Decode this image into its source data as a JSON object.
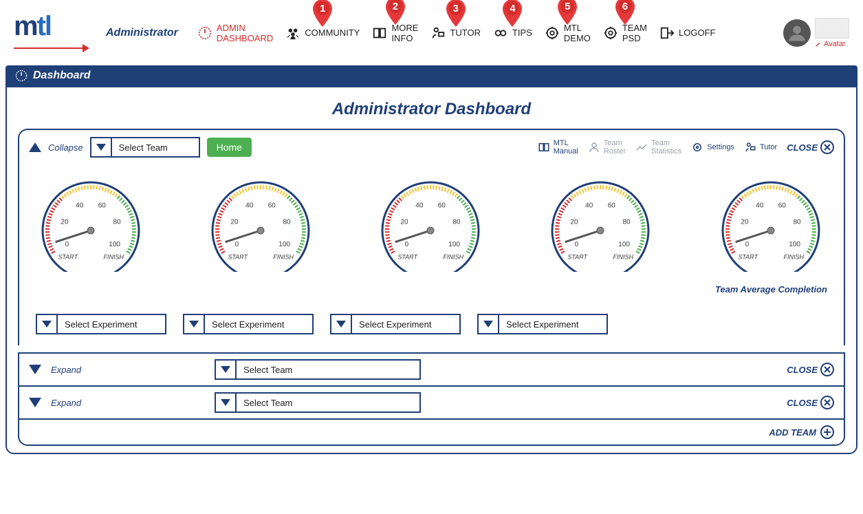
{
  "header": {
    "logo_text": "mtl",
    "role": "Administrator",
    "nav": [
      {
        "id": "admin-dashboard",
        "line1": "ADMIN",
        "line2": "DASHBOARD",
        "accent": true,
        "pin": null
      },
      {
        "id": "community",
        "line1": "COMMUNITY",
        "line2": "",
        "pin": "1"
      },
      {
        "id": "more-info",
        "line1": "MORE",
        "line2": "INFO",
        "pin": "2"
      },
      {
        "id": "tutor",
        "line1": "TUTOR",
        "line2": "",
        "pin": "3"
      },
      {
        "id": "tips",
        "line1": "TIPS",
        "line2": "",
        "pin": "4"
      },
      {
        "id": "mtl-demo",
        "line1": "MTL",
        "line2": "DEMO",
        "pin": "5"
      },
      {
        "id": "team-psd",
        "line1": "TEAM",
        "line2": "PSD",
        "pin": "6"
      },
      {
        "id": "logoff",
        "line1": "LOGOFF",
        "line2": "",
        "pin": null
      }
    ],
    "avatar_label": "Avatar"
  },
  "strip": {
    "title": "Dashboard"
  },
  "page": {
    "title": "Administrator Dashboard"
  },
  "team_card": {
    "collapse_label": "Collapse",
    "select_team": "Select Team",
    "home": "Home",
    "tools": [
      {
        "id": "mtl-manual",
        "line1": "MTL",
        "line2": "Manual",
        "disabled": false
      },
      {
        "id": "team-roster",
        "line1": "Team",
        "line2": "Roster",
        "disabled": true
      },
      {
        "id": "team-statistics",
        "line1": "Team",
        "line2": "Statistics",
        "disabled": true
      },
      {
        "id": "settings",
        "line1": "Settings",
        "line2": "",
        "disabled": false
      },
      {
        "id": "tutor",
        "line1": "Tutor",
        "line2": "",
        "disabled": false
      }
    ],
    "close": "CLOSE",
    "gauge": {
      "ticks": [
        "0",
        "20",
        "40",
        "60",
        "80",
        "100"
      ],
      "start": "START",
      "finish": "FINISH",
      "needle_value": 5,
      "avg_caption": "Team Average Completion"
    },
    "select_experiment": "Select Experiment"
  },
  "rows": [
    {
      "expand": "Expand",
      "select": "Select Team",
      "close": "CLOSE"
    },
    {
      "expand": "Expand",
      "select": "Select Team",
      "close": "CLOSE"
    }
  ],
  "add_team": "ADD TEAM"
}
